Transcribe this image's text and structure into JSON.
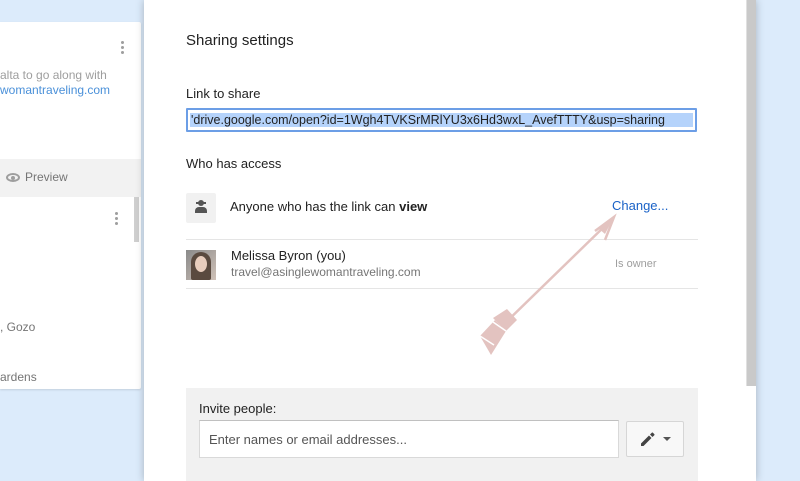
{
  "background_card": {
    "text_line_1": "alta to go along with",
    "link_text": "womantraveling.com",
    "preview_label": "Preview",
    "place_1": ", Gozo",
    "place_2": "ardens"
  },
  "dialog": {
    "title": "Sharing settings",
    "link_label": "Link to share",
    "link_value": "'drive.google.com/open?id=1Wgh4TVKSrMRlYU3x6Hd3wxL_AvefTTTY&usp=sharing",
    "who_has_access_label": "Who has access",
    "access": {
      "text_prefix": "Anyone who has the link can ",
      "text_bold": "view",
      "change_label": "Change..."
    },
    "owner": {
      "name": "Melissa Byron (you)",
      "email": "travel@asinglewomantraveling.com",
      "role": "Is owner"
    },
    "invite": {
      "label": "Invite people:",
      "placeholder": "Enter names or email addresses..."
    }
  },
  "colors": {
    "background": "#dcebfb",
    "link_blue": "#1a62c7",
    "selection": "#b5d3fb",
    "annotation_arrow": "#e3c3c0"
  },
  "icons": [
    "eye-icon",
    "kebab-menu-icon",
    "link-user-icon",
    "pencil-icon",
    "caret-down-icon",
    "annotation-arrow"
  ]
}
